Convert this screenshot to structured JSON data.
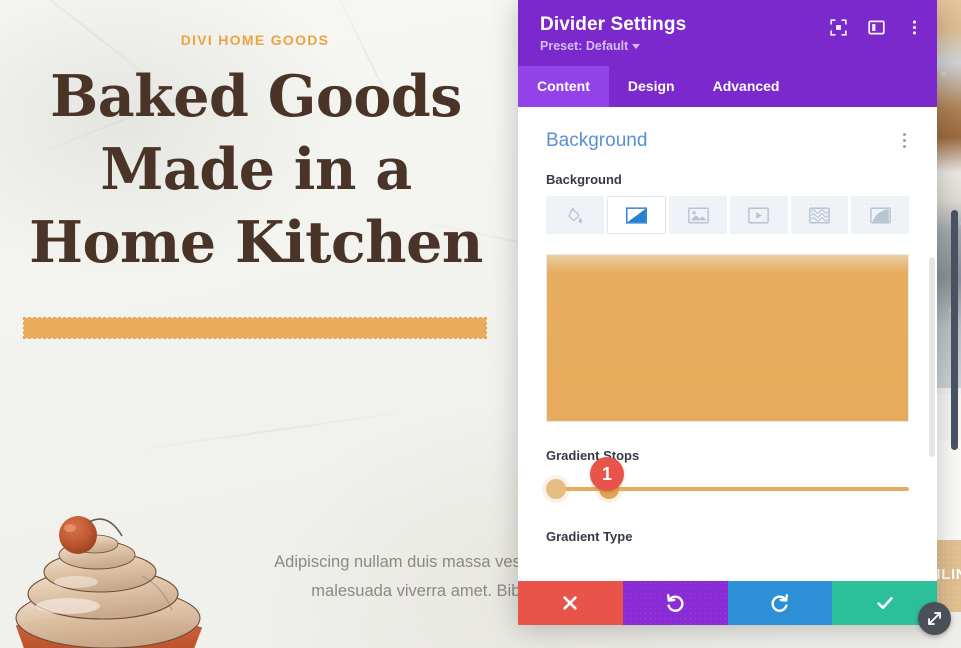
{
  "page": {
    "eyebrow": "DIVI HOME GOODS",
    "headline_lines": [
      "Baked Goods",
      "Made in a",
      "Home Kitchen"
    ],
    "body_text": "Adipiscing nullam duis massa vestibulum est. Eu, hac nisl, odio egestas malesuada viverra amet. Bibendum diam erat lobortis posuer.",
    "cta_strip_text": "AILING",
    "colors": {
      "eyebrow": "#eaa441",
      "headline": "#4a3327",
      "divider_bar": "#e8ac5c",
      "body_text": "#8d8882"
    }
  },
  "modal": {
    "title": "Divider Settings",
    "preset_label": "Preset: Default",
    "header_icons": [
      {
        "name": "focus-icon"
      },
      {
        "name": "layout-panel-icon"
      },
      {
        "name": "more-options-icon"
      }
    ],
    "tabs": [
      {
        "label": "Content",
        "active": true
      },
      {
        "label": "Design",
        "active": false
      },
      {
        "label": "Advanced",
        "active": false
      }
    ],
    "section": {
      "title": "Background",
      "field_label": "Background",
      "background_types": [
        {
          "name": "background-color-icon",
          "title": "Background Color",
          "active": false
        },
        {
          "name": "background-gradient-icon",
          "title": "Background Gradient",
          "active": true
        },
        {
          "name": "background-image-icon",
          "title": "Background Image",
          "active": false
        },
        {
          "name": "background-video-icon",
          "title": "Background Video",
          "active": false
        },
        {
          "name": "background-pattern-icon",
          "title": "Background Pattern",
          "active": false
        },
        {
          "name": "background-mask-icon",
          "title": "Background Mask",
          "active": false
        }
      ],
      "gradient_preview_colors": [
        "#ecd0a4",
        "#e6ab5b"
      ],
      "stops_label": "Gradient Stops",
      "stops": [
        {
          "position": 0,
          "color": "#e5bd84"
        },
        {
          "position": 14,
          "color": "#e3a453"
        }
      ],
      "gradient_type_label": "Gradient Type"
    },
    "footer_buttons": [
      {
        "name": "cancel-button",
        "icon": "close-icon",
        "color": "#e8544a"
      },
      {
        "name": "undo-button",
        "icon": "undo-icon",
        "color": "#8b2bd6"
      },
      {
        "name": "redo-button",
        "icon": "redo-icon",
        "color": "#2d8fd5"
      },
      {
        "name": "save-button",
        "icon": "checkmark-icon",
        "color": "#2bbf9a"
      }
    ]
  },
  "annotations": {
    "badge_1": "1"
  }
}
